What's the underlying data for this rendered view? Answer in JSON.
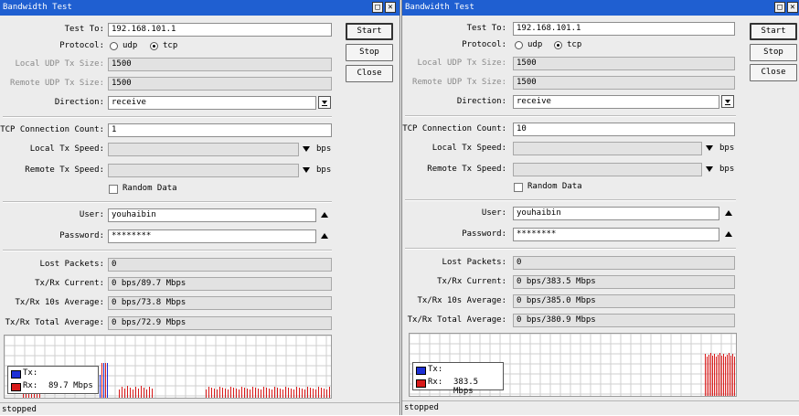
{
  "colors": {
    "titlebar": "#1f5fd1",
    "tx": "#1c2fd6",
    "rx": "#d81a1a",
    "grid": "#cfcfcf"
  },
  "icons": {
    "restore": "restore-icon",
    "close": "close-icon"
  },
  "windows": [
    {
      "title": "Bandwidth Test",
      "labels": {
        "test_to": "Test To:",
        "protocol": "Protocol:",
        "local_udp": "Local UDP Tx Size:",
        "remote_udp": "Remote UDP Tx Size:",
        "direction": "Direction:",
        "tcp_count": "TCP Connection Count:",
        "local_tx": "Local Tx Speed:",
        "remote_tx": "Remote Tx Speed:",
        "random": "Random Data",
        "user": "User:",
        "password": "Password:",
        "lost": "Lost Packets:",
        "current": "Tx/Rx Current:",
        "avg10": "Tx/Rx 10s Average:",
        "total": "Tx/Rx Total Average:",
        "udp": "udp",
        "tcp": "tcp",
        "bps": "bps"
      },
      "values": {
        "test_to": "192.168.101.1",
        "local_udp": "1500",
        "remote_udp": "1500",
        "direction": "receive",
        "tcp_count": "1",
        "local_tx": "",
        "remote_tx": "",
        "user": "youhaibin",
        "password": "********",
        "lost": "0",
        "current": "0 bps/89.7 Mbps",
        "avg10": "0 bps/73.8 Mbps",
        "total": "0 bps/72.9 Mbps"
      },
      "protocol_selected": "tcp",
      "random_data_checked": false,
      "buttons": {
        "start": "Start",
        "stop": "Stop",
        "close": "Close"
      },
      "legend": {
        "tx": "Tx:",
        "tx_value": "",
        "rx": "Rx:",
        "rx_value": "89.7 Mbps"
      },
      "status": "stopped"
    },
    {
      "title": "Bandwidth Test",
      "labels": {
        "test_to": "Test To:",
        "protocol": "Protocol:",
        "local_udp": "Local UDP Tx Size:",
        "remote_udp": "Remote UDP Tx Size:",
        "direction": "Direction:",
        "tcp_count": "TCP Connection Count:",
        "local_tx": "Local Tx Speed:",
        "remote_tx": "Remote Tx Speed:",
        "random": "Random Data",
        "user": "User:",
        "password": "Password:",
        "lost": "Lost Packets:",
        "current": "Tx/Rx Current:",
        "avg10": "Tx/Rx 10s Average:",
        "total": "Tx/Rx Total Average:",
        "udp": "udp",
        "tcp": "tcp",
        "bps": "bps"
      },
      "values": {
        "test_to": "192.168.101.1",
        "local_udp": "1500",
        "remote_udp": "1500",
        "direction": "receive",
        "tcp_count": "10",
        "local_tx": "",
        "remote_tx": "",
        "user": "youhaibin",
        "password": "********",
        "lost": "0",
        "current": "0 bps/383.5 Mbps",
        "avg10": "0 bps/385.0 Mbps",
        "total": "0 bps/380.9 Mbps"
      },
      "protocol_selected": "tcp",
      "random_data_checked": false,
      "buttons": {
        "start": "Start",
        "stop": "Stop",
        "close": "Close"
      },
      "legend": {
        "tx": "Tx:",
        "tx_value": "",
        "rx": "Rx:",
        "rx_value": "383.5 Mbps"
      },
      "status": "stopped"
    }
  ]
}
